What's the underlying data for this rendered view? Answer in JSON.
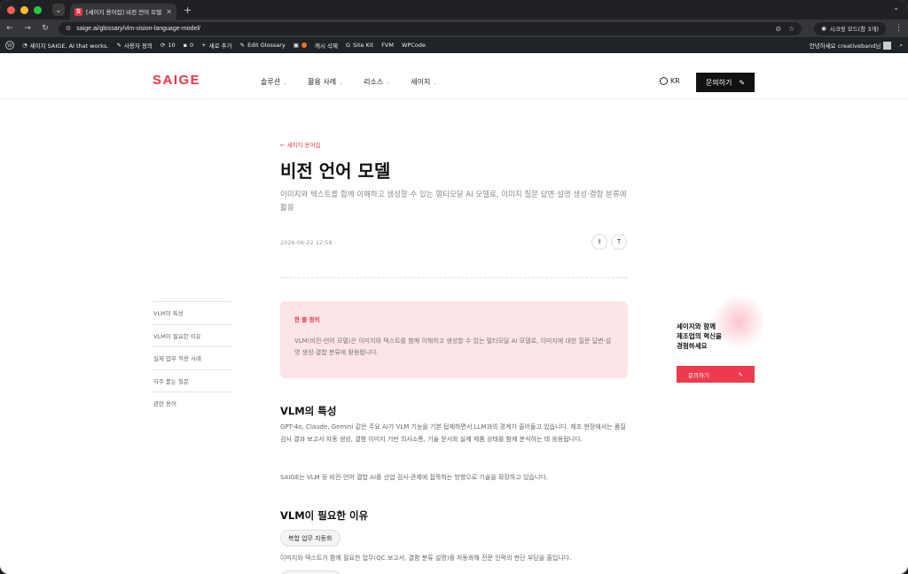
{
  "browser": {
    "tab_title": "[세이지 용어집] 비전 언어 모델 – S",
    "favicon_letter": "S",
    "url": "saige.ai/glossary/vlm-vision-language-model/",
    "incognito_label": "시크릿 모드(창 3개)"
  },
  "wp_admin": {
    "site_name": "세이지 SAIGE, AI that works.",
    "customize": "사용자 정의",
    "updates": "10",
    "comments": "0",
    "new": "새로 추가",
    "edit": "Edit Glossary",
    "cache": "캐시 삭제",
    "sitekit": "Site Kit",
    "fvm": "FVM",
    "wpcode": "WPCode",
    "greeting": "안녕하세요 creativeband님"
  },
  "header": {
    "logo": "SAIGE",
    "nav": [
      "솔루션",
      "활용 사례",
      "리소스",
      "세이지"
    ],
    "lang": "KR",
    "contact": "문의하기"
  },
  "article": {
    "back_link": "← 세이지 용어집",
    "title": "비전 언어 모델",
    "description": "이미지와 텍스트를 함께 이해하고 생성할 수 있는 멀티모달 AI 모델로, 이미지 질문 답변·설명 생성·결합 분류에 활용",
    "date": "2026-06-22 12:58",
    "definition_label": "한 줄 정의",
    "definition_text": "VLM(비전-언어 모델)은 이미지와 텍스트를 함께 이해하고 생성할 수 있는 멀티모달 AI 모델로, 이미지에 대한 질문 답변·설명 생성·결합 분류에 활용됩니다.",
    "section1_title": "VLM의 특성",
    "section1_p1": "GPT-4o, Claude, Gemini 같은 주요 AI가 VLM 기능을 기본 탑재하면서 LLM과의 경계가 줄어들고 있습니다. 제조 현장에서는 품질 검사 결과 보고서 자동 생성, 결함 이미지 기반 의사소통, 기술 문서와 실제 제품 상태를 함께 분석하는 데 응용됩니다.",
    "section1_p2": "SAIGE는 VLM 등 비전-언어 결합 AI를 산업 검사·관제에 접목하는 방향으로 기술을 확장하고 있습니다.",
    "section2_title": "VLM이 필요한 이유",
    "pill": "복합 업무 자동화",
    "section2_p1": "이미지와 텍스트가 함께 필요한 업무(QC 보고서, 결함 분류 설명)를 자동화해 전문 인력의 판단 부담을 줄입니다."
  },
  "toc": [
    "VLM의 특성",
    "VLM이 필요한 이유",
    "실제 업무 적용 사례",
    "자주 묻는 질문",
    "관련 용어"
  ],
  "promo": {
    "line1": "세이지와 함께",
    "line2": "제조업의 혁신을",
    "line3": "경험하세요",
    "button": "문의하기"
  }
}
